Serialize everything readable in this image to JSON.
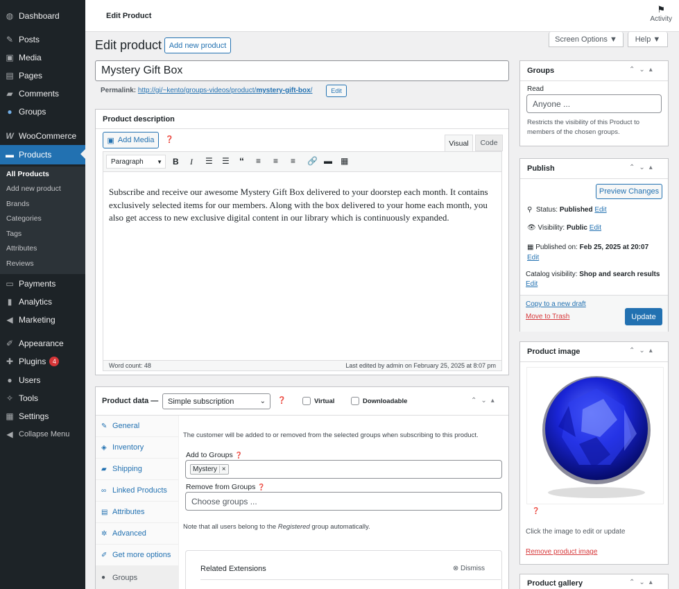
{
  "menu": {
    "dashboard": "Dashboard",
    "posts": "Posts",
    "media": "Media",
    "pages": "Pages",
    "comments": "Comments",
    "groups": "Groups",
    "woocommerce": "WooCommerce",
    "products": "Products",
    "payments": "Payments",
    "analytics": "Analytics",
    "marketing": "Marketing",
    "appearance": "Appearance",
    "plugins": "Plugins",
    "plugins_badge": "4",
    "users": "Users",
    "tools": "Tools",
    "settings": "Settings",
    "collapse": "Collapse Menu"
  },
  "submenu": {
    "all": "All Products",
    "add": "Add new product",
    "brands": "Brands",
    "categories": "Categories",
    "tags": "Tags",
    "attributes": "Attributes",
    "reviews": "Reviews"
  },
  "topbar": {
    "title": "Edit Product",
    "activity": "Activity"
  },
  "screen_options": "Screen Options ▼",
  "help": "Help ▼",
  "heading": "Edit product",
  "add_new": "Add new product",
  "product_title": "Mystery Gift Box",
  "permalink": {
    "label": "Permalink:",
    "url_prefix": "http://gi/~kento/groups-videos/product/",
    "slug": "mystery-gift-box",
    "url_suffix": "/",
    "edit": "Edit"
  },
  "description": {
    "title": "Product description",
    "add_media": "Add Media",
    "tab_visual": "Visual",
    "tab_code": "Code",
    "format": "Paragraph",
    "body": "Subscribe and receive our awesome Mystery Gift Box delivered to your doorstep each month. It contains exclusively selected items for our members. Along with the box delivered to your home each month, you also get access to new exclusive digital content in our library which is continuously expanded.",
    "word_count": "Word count: 48",
    "last_edited": "Last edited by admin on February 25, 2025 at 8:07 pm"
  },
  "product_data": {
    "title": "Product data —",
    "type": "Simple subscription",
    "virtual": "Virtual",
    "downloadable": "Downloadable",
    "tabs": [
      "General",
      "Inventory",
      "Shipping",
      "Linked Products",
      "Attributes",
      "Advanced",
      "Get more options",
      "Groups"
    ],
    "info": "The customer will be added to or removed from the selected groups when subscribing to this product.",
    "add_to_groups": "Add to Groups",
    "chip": "Mystery",
    "chip_x": "×",
    "remove_from_groups": "Remove from Groups",
    "choose": "Choose groups ...",
    "note_pre": "Note that all users belong to the ",
    "note_em": "Registered",
    "note_post": " group automatically.",
    "related": "Related Extensions",
    "dismiss": "Dismiss"
  },
  "groups_box": {
    "title": "Groups",
    "read": "Read",
    "placeholder": "Anyone ...",
    "desc": "Restricts the visibility of this Product to members of the chosen groups."
  },
  "publish": {
    "title": "Publish",
    "preview": "Preview Changes",
    "status_label": "Status:",
    "status": "Published",
    "visibility_label": "Visibility:",
    "visibility": "Public",
    "published_label": "Published on:",
    "published": "Feb 25, 2025 at 20:07",
    "catalog_label": "Catalog visibility:",
    "catalog": "Shop and search results",
    "edit": "Edit",
    "copy": "Copy to a new draft",
    "trash": "Move to Trash",
    "update": "Update"
  },
  "image_box": {
    "title": "Product image",
    "hint": "Click the image to edit or update",
    "remove": "Remove product image"
  },
  "gallery": {
    "title": "Product gallery"
  },
  "colors": {
    "primary": "#2271b1",
    "sidebar": "#1d2327",
    "danger": "#d63638"
  }
}
